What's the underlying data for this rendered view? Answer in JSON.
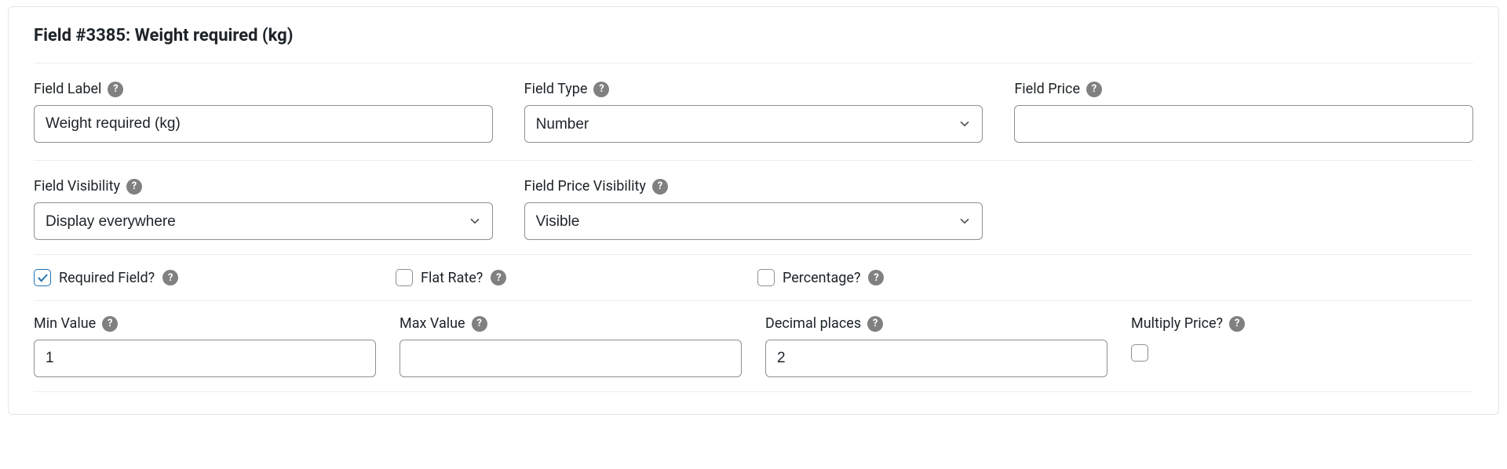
{
  "panel": {
    "title": "Field #3385: Weight required (kg)"
  },
  "fields": {
    "field_label": {
      "label": "Field Label",
      "value": "Weight required (kg)"
    },
    "field_type": {
      "label": "Field Type",
      "value": "Number"
    },
    "field_price": {
      "label": "Field Price",
      "value": ""
    },
    "field_visibility": {
      "label": "Field Visibility",
      "value": "Display everywhere"
    },
    "field_price_visibility": {
      "label": "Field Price Visibility",
      "value": "Visible"
    },
    "required_field": {
      "label": "Required Field?",
      "checked": true
    },
    "flat_rate": {
      "label": "Flat Rate?",
      "checked": false
    },
    "percentage": {
      "label": "Percentage?",
      "checked": false
    },
    "min_value": {
      "label": "Min Value",
      "value": "1"
    },
    "max_value": {
      "label": "Max Value",
      "value": ""
    },
    "decimal_places": {
      "label": "Decimal places",
      "value": "2"
    },
    "multiply_price": {
      "label": "Multiply Price?",
      "checked": false
    }
  }
}
